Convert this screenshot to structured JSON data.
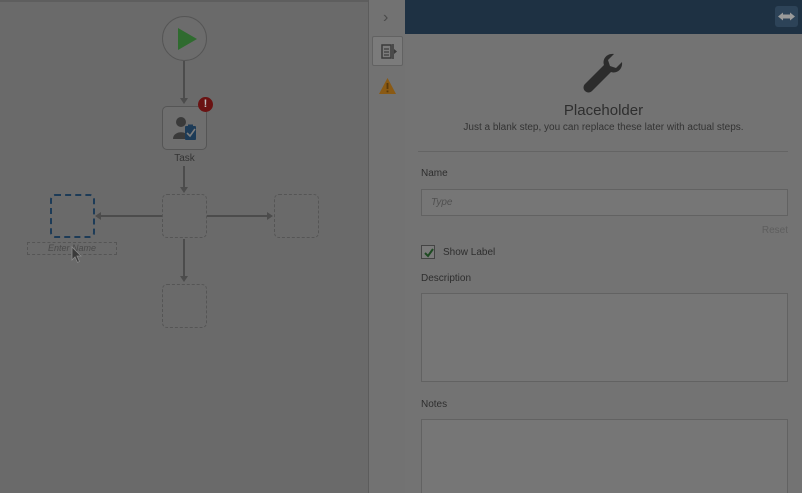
{
  "canvas": {
    "start_node": "play-icon",
    "task_node": {
      "label": "Task",
      "icon": "user-clipboard-icon",
      "error_badge": "!"
    },
    "name_input_placeholder": "Enter Name"
  },
  "toolbar": {
    "collapse": "›",
    "items": [
      {
        "name": "properties-icon"
      },
      {
        "name": "warning-icon"
      }
    ]
  },
  "panel": {
    "header_button_icon": "expand-icon",
    "icon": "wrench-icon",
    "title": "Placeholder",
    "subtitle": "Just a blank step, you can replace these later with actual steps.",
    "name_label": "Name",
    "name_placeholder": "Type",
    "reset_label": "Reset",
    "show_label_text": "Show Label",
    "show_label_checked": true,
    "description_label": "Description",
    "notes_label": "Notes"
  },
  "colors": {
    "header": "#1e3143",
    "start_icon": "#2f6b2f",
    "task_icon": "#1d3b57",
    "error": "#6a1313",
    "warning": "#8a5a14"
  }
}
